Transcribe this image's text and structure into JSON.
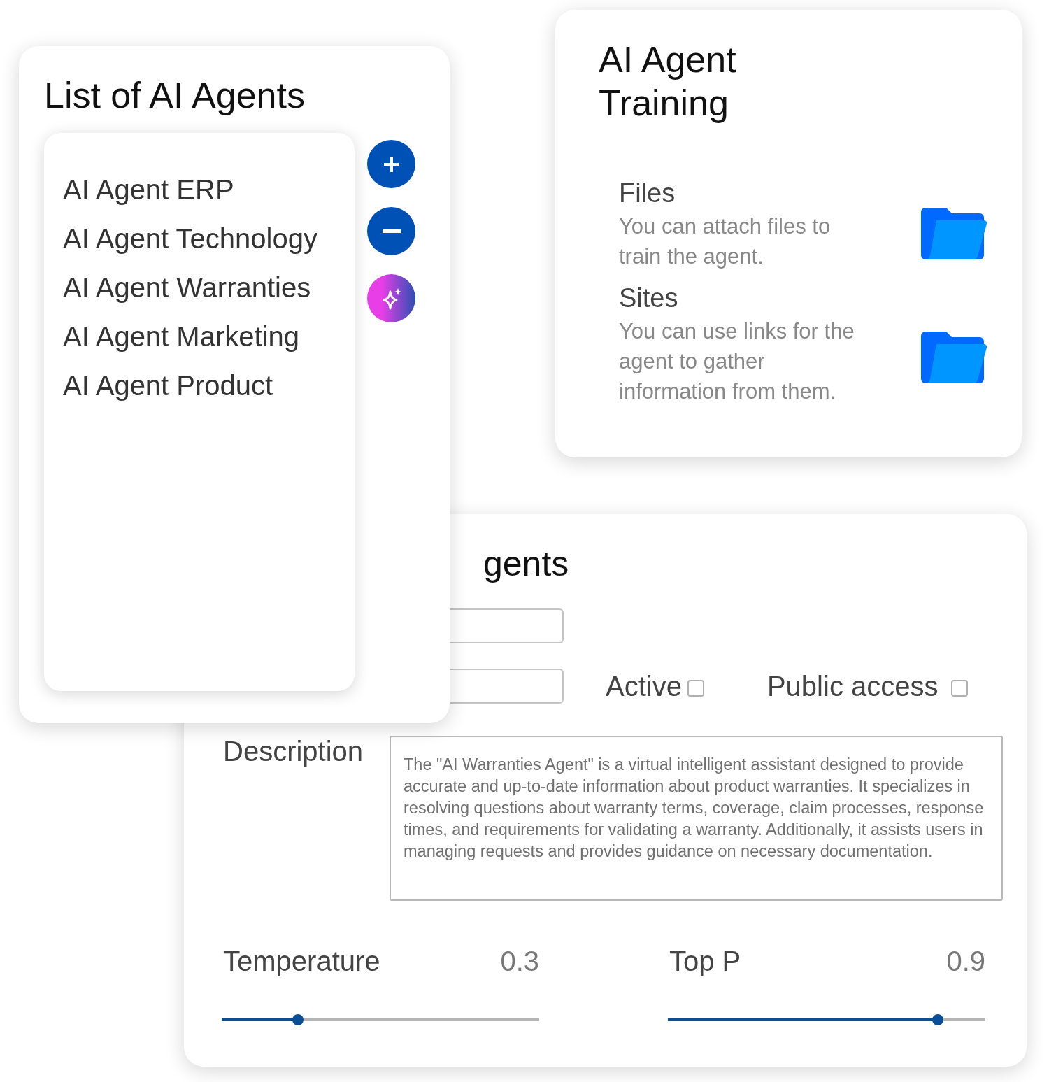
{
  "agent_form": {
    "title": "gents",
    "fields": [
      {
        "kind": "text"
      },
      {
        "kind": "text"
      }
    ],
    "checkboxes": [
      {
        "label": "Active",
        "checked": false
      },
      {
        "label": "Public access",
        "checked": false
      }
    ],
    "description": {
      "label": "Description",
      "value": "The \"AI Warranties Agent\" is a virtual intelligent assistant designed to provide accurate and up-to-date information about product warranties. It specializes in resolving questions about warranty terms, coverage, claim processes, response times, and requirements for validating a warranty. Additionally, it assists users in managing requests and provides guidance on necessary documentation."
    },
    "sliders": [
      {
        "label": "Temperature",
        "reading": "0.3",
        "level": 0.24
      },
      {
        "label": "Top P",
        "reading": "0.9",
        "level": 0.85
      }
    ]
  },
  "agent_list": {
    "title": "List of AI Agents",
    "items": [
      "AI Agent ERP",
      "AI Agent Technology",
      "AI Agent Warranties",
      "AI Agent Marketing",
      "AI Agent Product"
    ],
    "actions": [
      {
        "kind": "add"
      },
      {
        "kind": "remove"
      },
      {
        "kind": "ai"
      }
    ]
  },
  "training": {
    "title": "AI Agent Training",
    "sources": [
      {
        "title": "Files",
        "text": "You can attach files to train the agent."
      },
      {
        "title": "Sites",
        "text": "You can use links for the agent to gather information from them."
      }
    ]
  }
}
